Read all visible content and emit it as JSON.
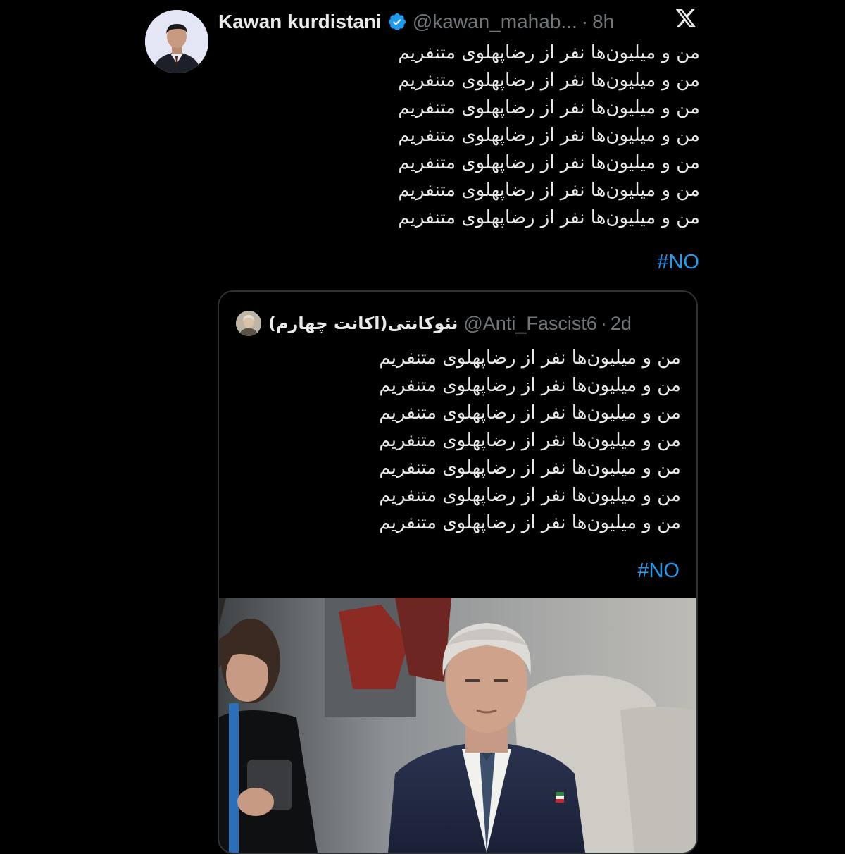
{
  "tweet": {
    "author": {
      "name": "Kawan kurdistani",
      "handle": "@kawan_mahab...",
      "time": "8h",
      "verified": true,
      "avatar_icon": "profile-photo"
    },
    "lines": [
      "من و میلیون‌ها نفر از رضاپهلوی متنفریم",
      "من و میلیون‌ها نفر از رضاپهلوی متنفریم",
      "من و میلیون‌ها نفر از رضاپهلوی متنفریم",
      "من و میلیون‌ها نفر از رضاپهلوی متنفریم",
      "من و میلیون‌ها نفر از رضاپهلوی متنفریم",
      "من و میلیون‌ها نفر از رضاپهلوی متنفریم",
      "من و میلیون‌ها نفر از رضاپهلوی متنفریم"
    ],
    "hashtag": "#NO"
  },
  "quoted": {
    "author": {
      "name": "نئوکانتی(اکانت چهارم)",
      "handle": "@Anti_Fascist6",
      "time": "2d",
      "avatar_icon": "portrait-avatar"
    },
    "lines": [
      "من و میلیون‌ها نفر از رضاپهلوی متنفریم",
      "من و میلیون‌ها نفر از رضاپهلوی متنفریم",
      "من و میلیون‌ها نفر از رضاپهلوی متنفریم",
      "من و میلیون‌ها نفر از رضاپهلوی متنفریم",
      "من و میلیون‌ها نفر از رضاپهلوی متنفریم",
      "من و میلیون‌ها نفر از رضاپهلوی متنفریم",
      "من و میلیون‌ها نفر از رضاپهلوی متنفریم"
    ],
    "hashtag": "#NO",
    "media_icon": "event-photo"
  },
  "dot_separator": "·",
  "app_icon": "x-logo-icon",
  "colors": {
    "background": "#000000",
    "text": "#e7e9ea",
    "muted": "#71767b",
    "accent": "#1d9bf0",
    "border": "#2f3336"
  }
}
